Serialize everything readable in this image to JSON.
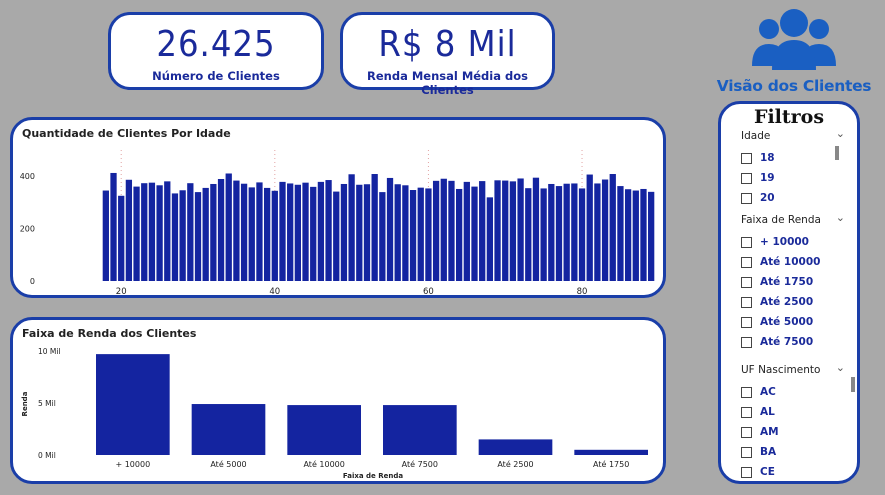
{
  "kpis": {
    "clients": {
      "value": "26.425",
      "label": "Número de Clientes"
    },
    "income": {
      "value": "R$ 8 Mil",
      "label": "Renda Mensal Média dos Clientes"
    }
  },
  "brand": {
    "title": "Visão dos Clientes",
    "icon": "people-group-icon",
    "color": "#1a5fc2"
  },
  "filters": {
    "title": "Filtros",
    "idade": {
      "label": "Idade",
      "items": [
        "18",
        "19",
        "20"
      ]
    },
    "faixa": {
      "label": "Faixa de Renda",
      "items": [
        "+ 10000",
        "Até 10000",
        "Até 1750",
        "Até 2500",
        "Até 5000",
        "Até 7500"
      ]
    },
    "uf": {
      "label": "UF Nascimento",
      "items": [
        "AC",
        "AL",
        "AM",
        "BA",
        "CE"
      ]
    }
  },
  "colors": {
    "bar": "#1424a0",
    "border": "#1a3ea8",
    "background": "#a9a9a9"
  },
  "chart_data": [
    {
      "type": "bar",
      "title": "Quantidade de Clientes Por Idade",
      "xlabel": "",
      "ylabel": "",
      "ylim": [
        0,
        450
      ],
      "yticks": [
        0,
        200,
        400
      ],
      "xticks": [
        20,
        40,
        60,
        80
      ],
      "x": [
        18,
        19,
        20,
        21,
        22,
        23,
        24,
        25,
        26,
        27,
        28,
        29,
        30,
        31,
        32,
        33,
        34,
        35,
        36,
        37,
        38,
        39,
        40,
        41,
        42,
        43,
        44,
        45,
        46,
        47,
        48,
        49,
        50,
        51,
        52,
        53,
        54,
        55,
        56,
        57,
        58,
        59,
        60,
        61,
        62,
        63,
        64,
        65,
        66,
        67,
        68,
        69,
        70,
        71,
        72,
        73,
        74,
        75,
        76,
        77,
        78,
        79,
        80,
        81,
        82,
        83,
        84,
        85,
        86,
        87,
        88,
        89
      ],
      "values": [
        345,
        412,
        325,
        386,
        360,
        373,
        375,
        365,
        380,
        334,
        346,
        373,
        339,
        355,
        370,
        389,
        410,
        383,
        371,
        357,
        376,
        355,
        344,
        378,
        372,
        367,
        375,
        359,
        378,
        385,
        341,
        370,
        407,
        367,
        369,
        408,
        339,
        393,
        369,
        365,
        347,
        356,
        353,
        382,
        390,
        382,
        351,
        378,
        360,
        381,
        319,
        384,
        383,
        380,
        391,
        354,
        394,
        353,
        370,
        362,
        371,
        372,
        353,
        406,
        372,
        387,
        408,
        362,
        350,
        345,
        351,
        340
      ],
      "legend": "none"
    },
    {
      "type": "bar",
      "title": "Faixa de Renda dos Clientes",
      "xlabel": "Faixa de Renda",
      "ylabel": "Renda",
      "ylim": [
        0,
        10000
      ],
      "ytick_labels": [
        "0 Mil",
        "5 Mil",
        "10 Mil"
      ],
      "categories": [
        "+ 10000",
        "Até 5000",
        "Até 10000",
        "Até 7500",
        "Até 2500",
        "Até 1750"
      ],
      "values": [
        9700,
        4900,
        4800,
        4800,
        1500,
        500
      ],
      "legend": "none"
    }
  ]
}
